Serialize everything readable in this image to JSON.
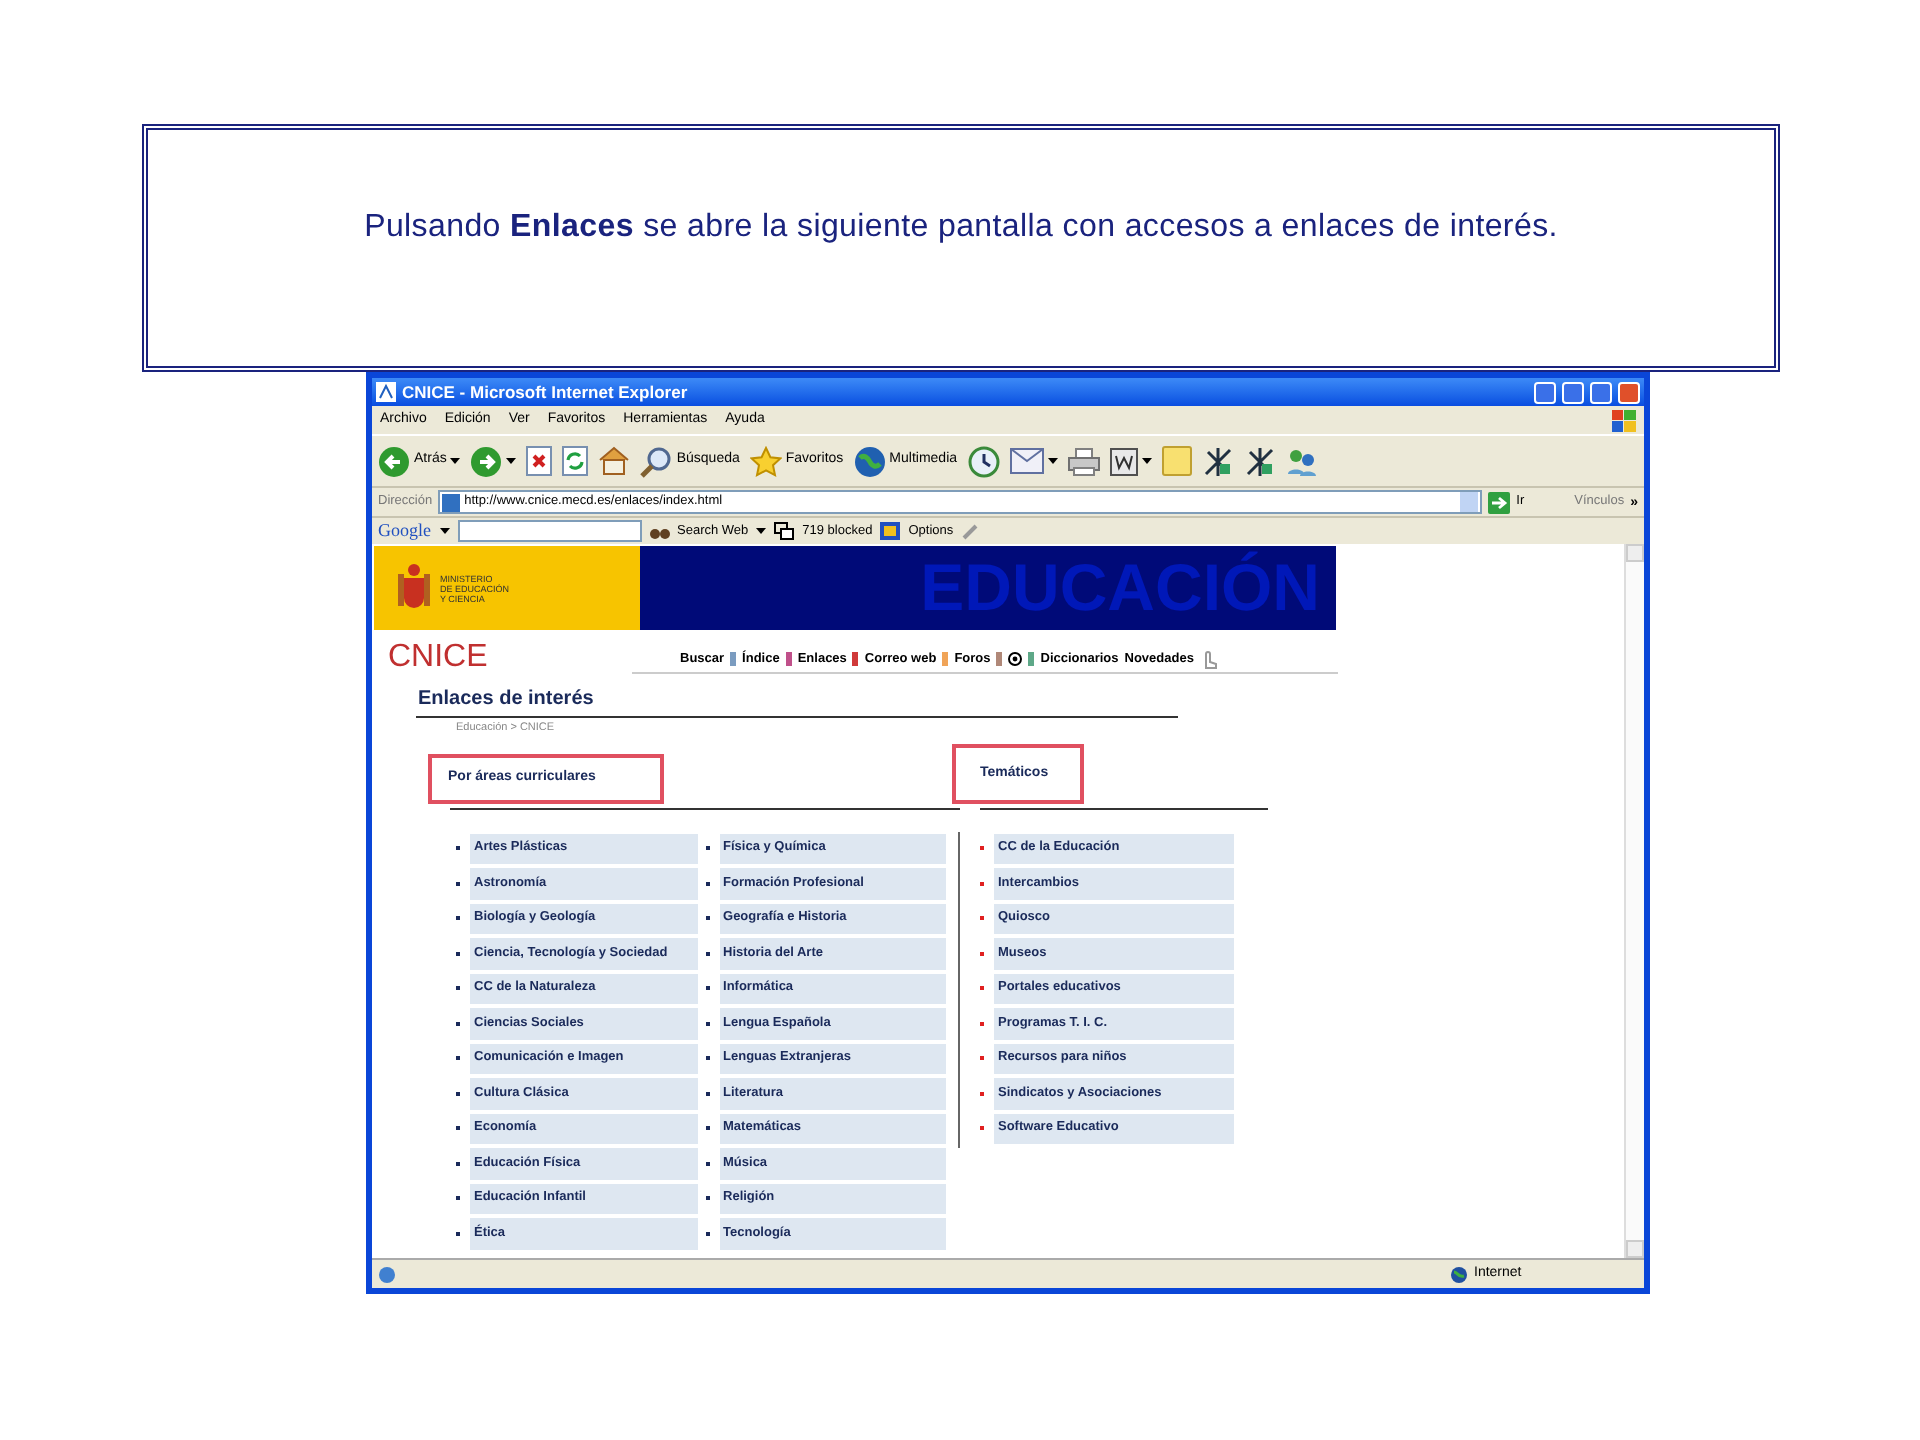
{
  "slide": {
    "caption": "Pulsando **Enlaces** se abre la siguiente pantalla con accesos a enlaces de interés."
  },
  "browser": {
    "title": "CNICE - Microsoft Internet Explorer",
    "menu": [
      "Archivo",
      "Edición",
      "Ver",
      "Favoritos",
      "Herramientas",
      "Ayuda"
    ],
    "toolbar": [
      {
        "kind": "back",
        "label": "Atrás"
      },
      {
        "kind": "forward"
      },
      {
        "kind": "stop"
      },
      {
        "kind": "refresh"
      },
      {
        "kind": "home"
      },
      {
        "kind": "search",
        "label": "Búsqueda"
      },
      {
        "kind": "favorites",
        "label": "Favoritos"
      },
      {
        "kind": "media",
        "label": "Multimedia"
      },
      {
        "kind": "history"
      },
      {
        "kind": "mail"
      },
      {
        "kind": "print"
      },
      {
        "kind": "edit"
      },
      {
        "kind": "note"
      },
      {
        "kind": "tool"
      },
      {
        "kind": "tool"
      },
      {
        "kind": "people"
      }
    ],
    "address_label": "Dirección",
    "address": "http://www.cnice.mecd.es/enlaces/index.html",
    "go": "Ir",
    "links": "Vínculos",
    "more": "»",
    "google": {
      "logo": "Google",
      "search": "Search Web",
      "blocked": "719 blocked",
      "options": "Options"
    },
    "status": "Internet"
  },
  "page": {
    "ministry": [
      "MINISTERIO",
      "DE EDUCACIÓN",
      "Y CIENCIA"
    ],
    "banner": "EDUCACIÓN",
    "logo": "CNICE",
    "nav": [
      {
        "kind": "text",
        "label": "Buscar",
        "color": "#7b9cc0"
      },
      {
        "kind": "text",
        "label": "Índice",
        "color": "#c0508a"
      },
      {
        "kind": "text",
        "label": "Enlaces",
        "color": "#d03a3a"
      },
      {
        "kind": "text",
        "label": "Correo web",
        "color": "#f0a458"
      },
      {
        "kind": "text",
        "label": "Foros",
        "color": "#b08878"
      },
      {
        "kind": "icon",
        "color": "#5ea888"
      },
      {
        "kind": "text",
        "label": "Diccionarios"
      },
      {
        "kind": "text",
        "label": "Novedades"
      }
    ],
    "heading": "Enlaces de interés",
    "breadcrumb": "Educación > CNICE",
    "sections": [
      {
        "title": "Por áreas curriculares",
        "highlighted": true,
        "columns": [
          [
            "Artes Plásticas",
            "Astronomía",
            "Biología y Geología",
            "Ciencia, Tecnología y Sociedad",
            "CC de la Naturaleza",
            "Ciencias Sociales",
            "Comunicación e Imagen",
            "Cultura Clásica",
            "Economía",
            "Educación Física",
            "Educación Infantil",
            "Ética"
          ],
          [
            "Física y Química",
            "Formación Profesional",
            "Geografía e Historia",
            "Historia del Arte",
            "Informática",
            "Lengua Española",
            "Lenguas Extranjeras",
            "Literatura",
            "Matemáticas",
            "Música",
            "Religión",
            "Tecnología"
          ]
        ]
      },
      {
        "title": "Temáticos",
        "highlighted": true,
        "columns": [
          [
            "CC de la Educación",
            "Intercambios",
            "Quiosco",
            "Museos",
            "Portales educativos",
            "Programas T. I. C.",
            "Recursos para niños",
            "Sindicatos y Asociaciones",
            "Software Educativo"
          ]
        ]
      }
    ]
  }
}
